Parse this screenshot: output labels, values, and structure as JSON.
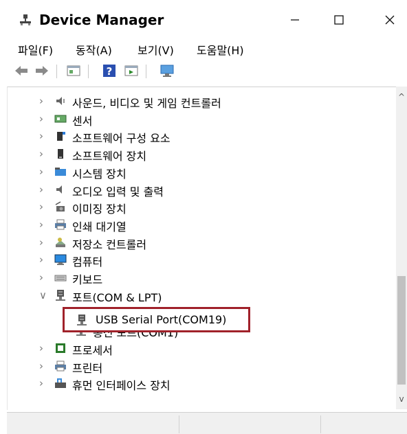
{
  "window": {
    "title": "Device Manager"
  },
  "menu": [
    "파일(F)",
    "동작(A)",
    "보기(V)",
    "도움말(H)"
  ],
  "tree": [
    {
      "label": "사운드, 비디오 및 게임 컨트롤러",
      "icon": "speaker-icon",
      "expanded": false
    },
    {
      "label": "센서",
      "icon": "sensor-icon",
      "expanded": false
    },
    {
      "label": "소프트웨어 구성 요소",
      "icon": "software-component-icon",
      "expanded": false
    },
    {
      "label": "소프트웨어 장치",
      "icon": "software-device-icon",
      "expanded": false
    },
    {
      "label": "시스템 장치",
      "icon": "system-device-icon",
      "expanded": false
    },
    {
      "label": "오디오 입력 및 출력",
      "icon": "audio-io-icon",
      "expanded": false
    },
    {
      "label": "이미징 장치",
      "icon": "camera-icon",
      "expanded": false
    },
    {
      "label": "인쇄 대기열",
      "icon": "printer-icon",
      "expanded": false
    },
    {
      "label": "저장소 컨트롤러",
      "icon": "storage-controller-icon",
      "expanded": false
    },
    {
      "label": "컴퓨터",
      "icon": "monitor-icon",
      "expanded": false
    },
    {
      "label": "키보드",
      "icon": "keyboard-icon",
      "expanded": false
    },
    {
      "label": "포트(COM & LPT)",
      "icon": "port-icon",
      "expanded": true,
      "children": [
        "USB Serial Port(COM19)",
        "통신 포트(COM1)"
      ]
    },
    {
      "label": "프로세서",
      "icon": "processor-icon",
      "expanded": false
    },
    {
      "label": "프린터",
      "icon": "printer-icon",
      "expanded": false
    },
    {
      "label": "휴먼 인터페이스 장치",
      "icon": "hid-icon",
      "expanded": false
    }
  ],
  "highlighted_item": "USB Serial Port(COM19)",
  "colors": {
    "highlight_border": "#a0212a",
    "accent": "#1a73c8"
  }
}
